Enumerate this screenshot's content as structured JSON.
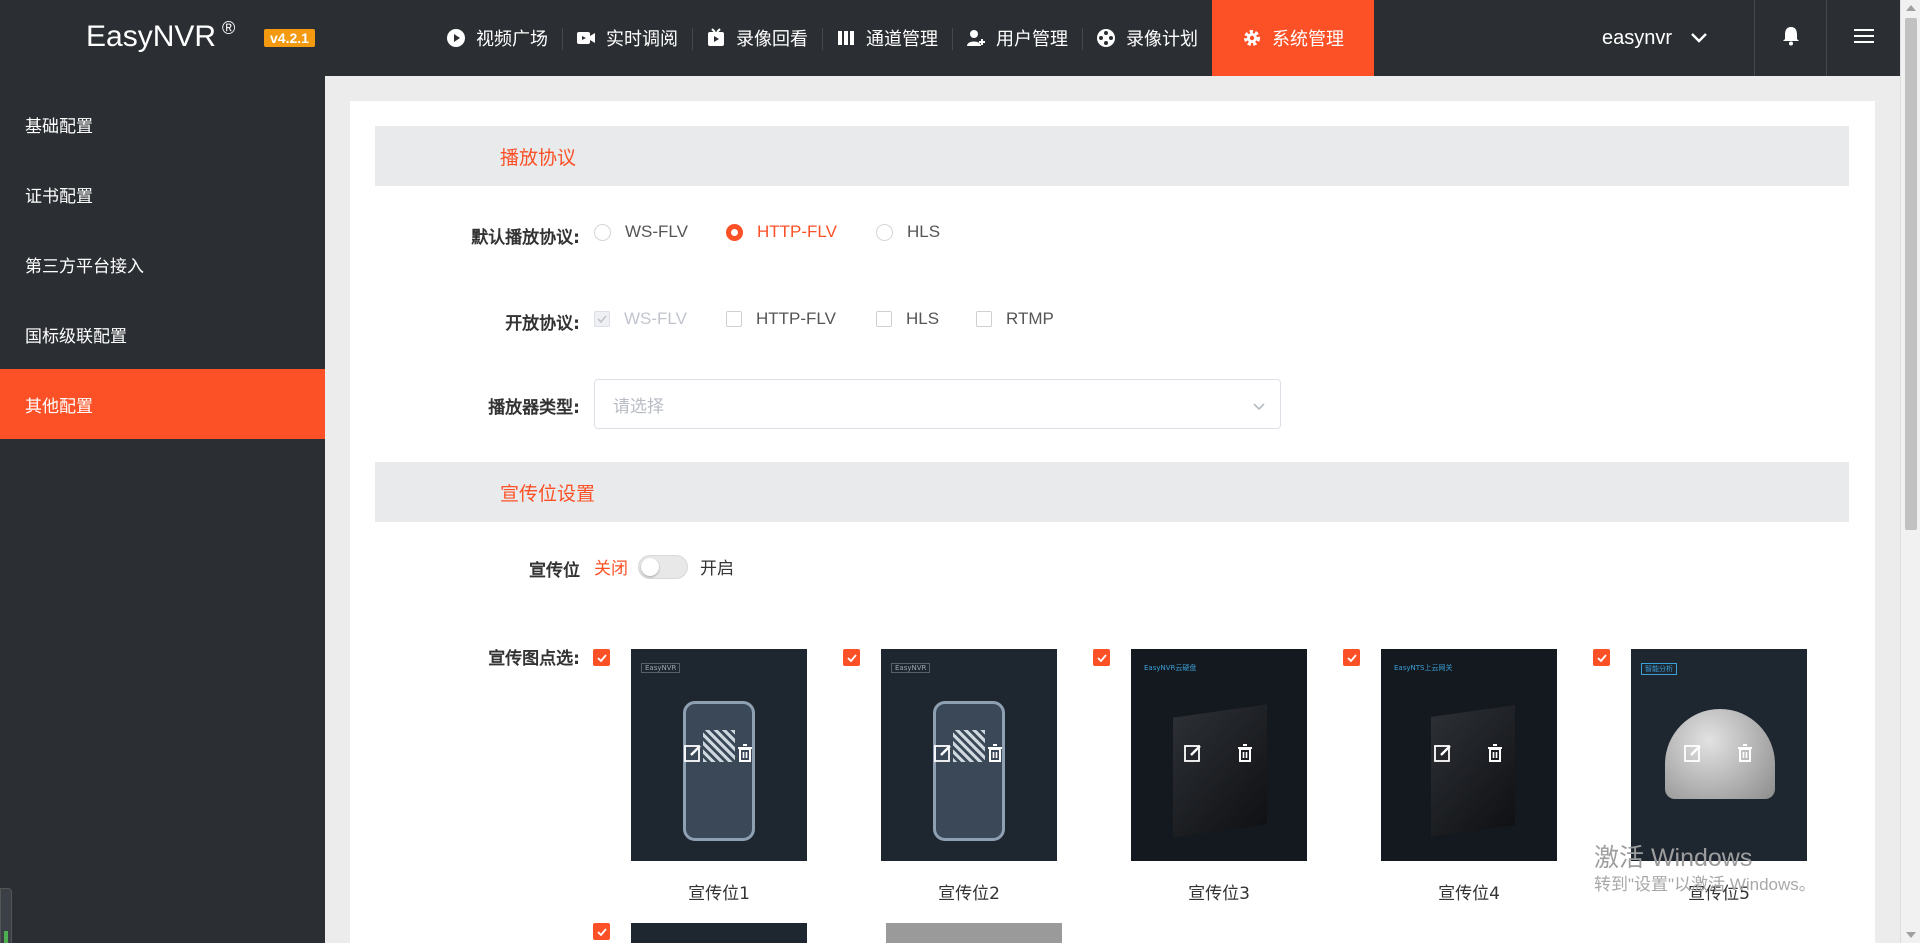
{
  "app": {
    "name": "EasyNVR",
    "registered": "®",
    "version": "v4.2.1"
  },
  "nav": {
    "items": [
      {
        "label": "视频广场",
        "icon": "play-circle-icon"
      },
      {
        "label": "实时调阅",
        "icon": "video-camera-icon"
      },
      {
        "label": "录像回看",
        "icon": "tv-play-icon"
      },
      {
        "label": "通道管理",
        "icon": "channels-icon"
      },
      {
        "label": "用户管理",
        "icon": "user-add-icon"
      },
      {
        "label": "录像计划",
        "icon": "film-reel-icon"
      },
      {
        "label": "系统管理",
        "icon": "gear-icon",
        "active": true
      }
    ],
    "user": "easynvr"
  },
  "sidebar": {
    "items": [
      {
        "label": "基础配置"
      },
      {
        "label": "证书配置"
      },
      {
        "label": "第三方平台接入"
      },
      {
        "label": "国标级联配置"
      },
      {
        "label": "其他配置",
        "active": true
      }
    ]
  },
  "play": {
    "section_title": "播放协议",
    "default_label": "默认播放协议:",
    "default_options": [
      "WS-FLV",
      "HTTP-FLV",
      "HLS"
    ],
    "default_selected": "HTTP-FLV",
    "open_label": "开放协议:",
    "open_options": [
      "WS-FLV",
      "HTTP-FLV",
      "HLS",
      "RTMP"
    ],
    "player_label": "播放器类型:",
    "player_placeholder": "请选择"
  },
  "promo": {
    "section_title": "宣传位设置",
    "switch_label": "宣传位",
    "off": "关闭",
    "on": "开启",
    "switch_state": "off",
    "images_label": "宣传图点选:",
    "ads": [
      {
        "label": "宣传位1",
        "tag": "EasyNVR",
        "checked": true
      },
      {
        "label": "宣传位2",
        "tag": "EasyNVR",
        "checked": true
      },
      {
        "label": "宣传位3",
        "tag": "EasyNVR云硬盘",
        "checked": true
      },
      {
        "label": "宣传位4",
        "tag": "EasyNTS上云网关",
        "checked": true
      },
      {
        "label": "宣传位5",
        "tag": "智能分析",
        "checked": true
      }
    ]
  },
  "watermark": {
    "line1": "激活 Windows",
    "line2": "转到\"设置\"以激活 Windows。"
  },
  "colors": {
    "accent": "#fc5126",
    "topbar": "#2b2f33",
    "version_badge": "#f39a10"
  }
}
